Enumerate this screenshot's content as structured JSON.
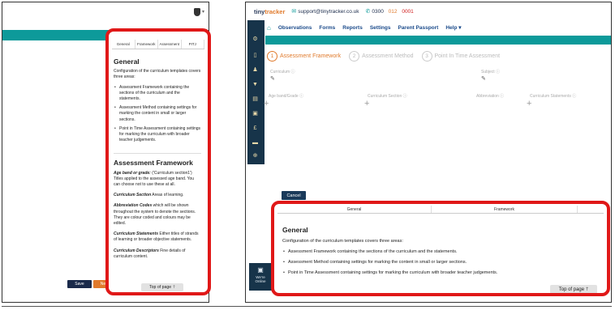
{
  "left_pane": {
    "buttons": {
      "save_label": "Save",
      "orange_label": "Ne"
    },
    "help": {
      "tabs": [
        "General",
        "Framework",
        "Assessment",
        "PITJ"
      ],
      "general_heading": "General",
      "general_intro": "Configuration of the curriculum templates covers three areas:",
      "general_items": [
        "Assessment Framework containing the sections of the curriculum and the statements.",
        "Assessment Method containing settings for marking the content in small or larger sections.",
        "Point in Time Assessment containing settings for marking the curriculum with broader teacher judgements."
      ],
      "framework_heading": "Assessment Framework",
      "definitions": [
        {
          "term": "Age band or grade:",
          "text": " ('Curriculum section1') Titles applied to the assessed age band. You can choose not to use these at all."
        },
        {
          "term": "Curriculum Section",
          "text": " Areas of learning."
        },
        {
          "term": "Abbreviation Codes",
          "text": " which will be shown throughout the system to denote the sections. They are colour coded and colours may be edited."
        },
        {
          "term": "Curriculum Statements",
          "text": " Either titles of strands of learning or broader objective statements."
        },
        {
          "term": "Curriculum Descriptors",
          "text": " Fine details of curriculum content."
        }
      ],
      "top_of_page": "Top of page"
    }
  },
  "right_pane": {
    "logo_main": "tiny",
    "logo_accent": "tracker",
    "email": "support@tinytracker.co.uk",
    "phone_a": "0300",
    "phone_b": "012",
    "phone_c": "0001",
    "nav": [
      "Observations",
      "Forms",
      "Reports",
      "Settings",
      "Parent Passport",
      "Help ▾"
    ],
    "steps": [
      {
        "num": "1",
        "label": "Assessment Framework"
      },
      {
        "num": "2",
        "label": "Assessment Method"
      },
      {
        "num": "3",
        "label": "Point In Time Assessment"
      }
    ],
    "fields": {
      "curriculum": "Curriculum ⓘ",
      "subject": "Subject ⓘ",
      "age_band": "Age band/Grade ⓘ",
      "curriculum_section": "Curriculum Section ⓘ",
      "abbreviation": "Abbreviation ⓘ",
      "curriculum_statements": "Curriculum Statements ⓘ"
    },
    "cancel_label": "Cancel",
    "chat": {
      "line1": "We're",
      "line2": "Online"
    },
    "help": {
      "tabs": [
        "General",
        "Framework"
      ],
      "heading": "General",
      "intro": "Configuration of the curriculum templates covers three areas:",
      "items": [
        "Assessment Framework containing the sections of the curriculum and the statements.",
        "Assessment Method containing settings for marking the content in small or larger sections.",
        "Point in Time Assessment containing settings for marking the curriculum with broader teacher judgements."
      ],
      "top_of_page": "Top of page"
    }
  },
  "colors": {
    "teal": "#0d9a9a",
    "navy": "#17344a",
    "orange": "#e07a2c",
    "highlight_red": "#e01818"
  },
  "icons": [
    "shield-icon",
    "home-icon",
    "email-icon",
    "phone-icon",
    "edit-icon",
    "plus-icon",
    "arrow-up-icon",
    "chat-icon",
    "hamburger-icon"
  ]
}
